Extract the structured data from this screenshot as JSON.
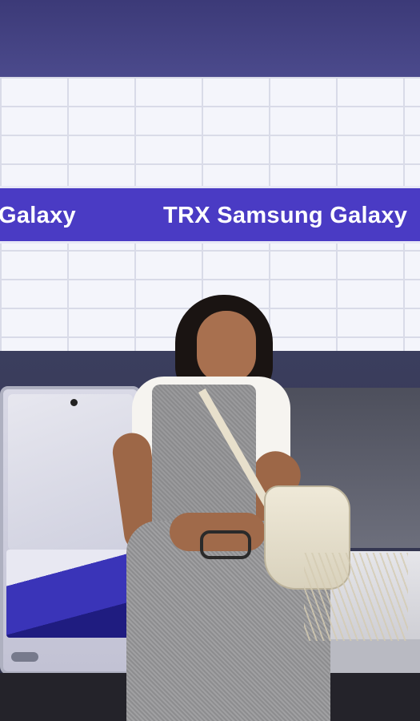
{
  "banner": {
    "left_text": "Galaxy",
    "right_text": "TRX Samsung Galaxy",
    "color": "#4a3bc4"
  },
  "scene": {
    "wall_tile_color": "#f4f5fb",
    "phone_bench_accent": "#3a34b8"
  }
}
